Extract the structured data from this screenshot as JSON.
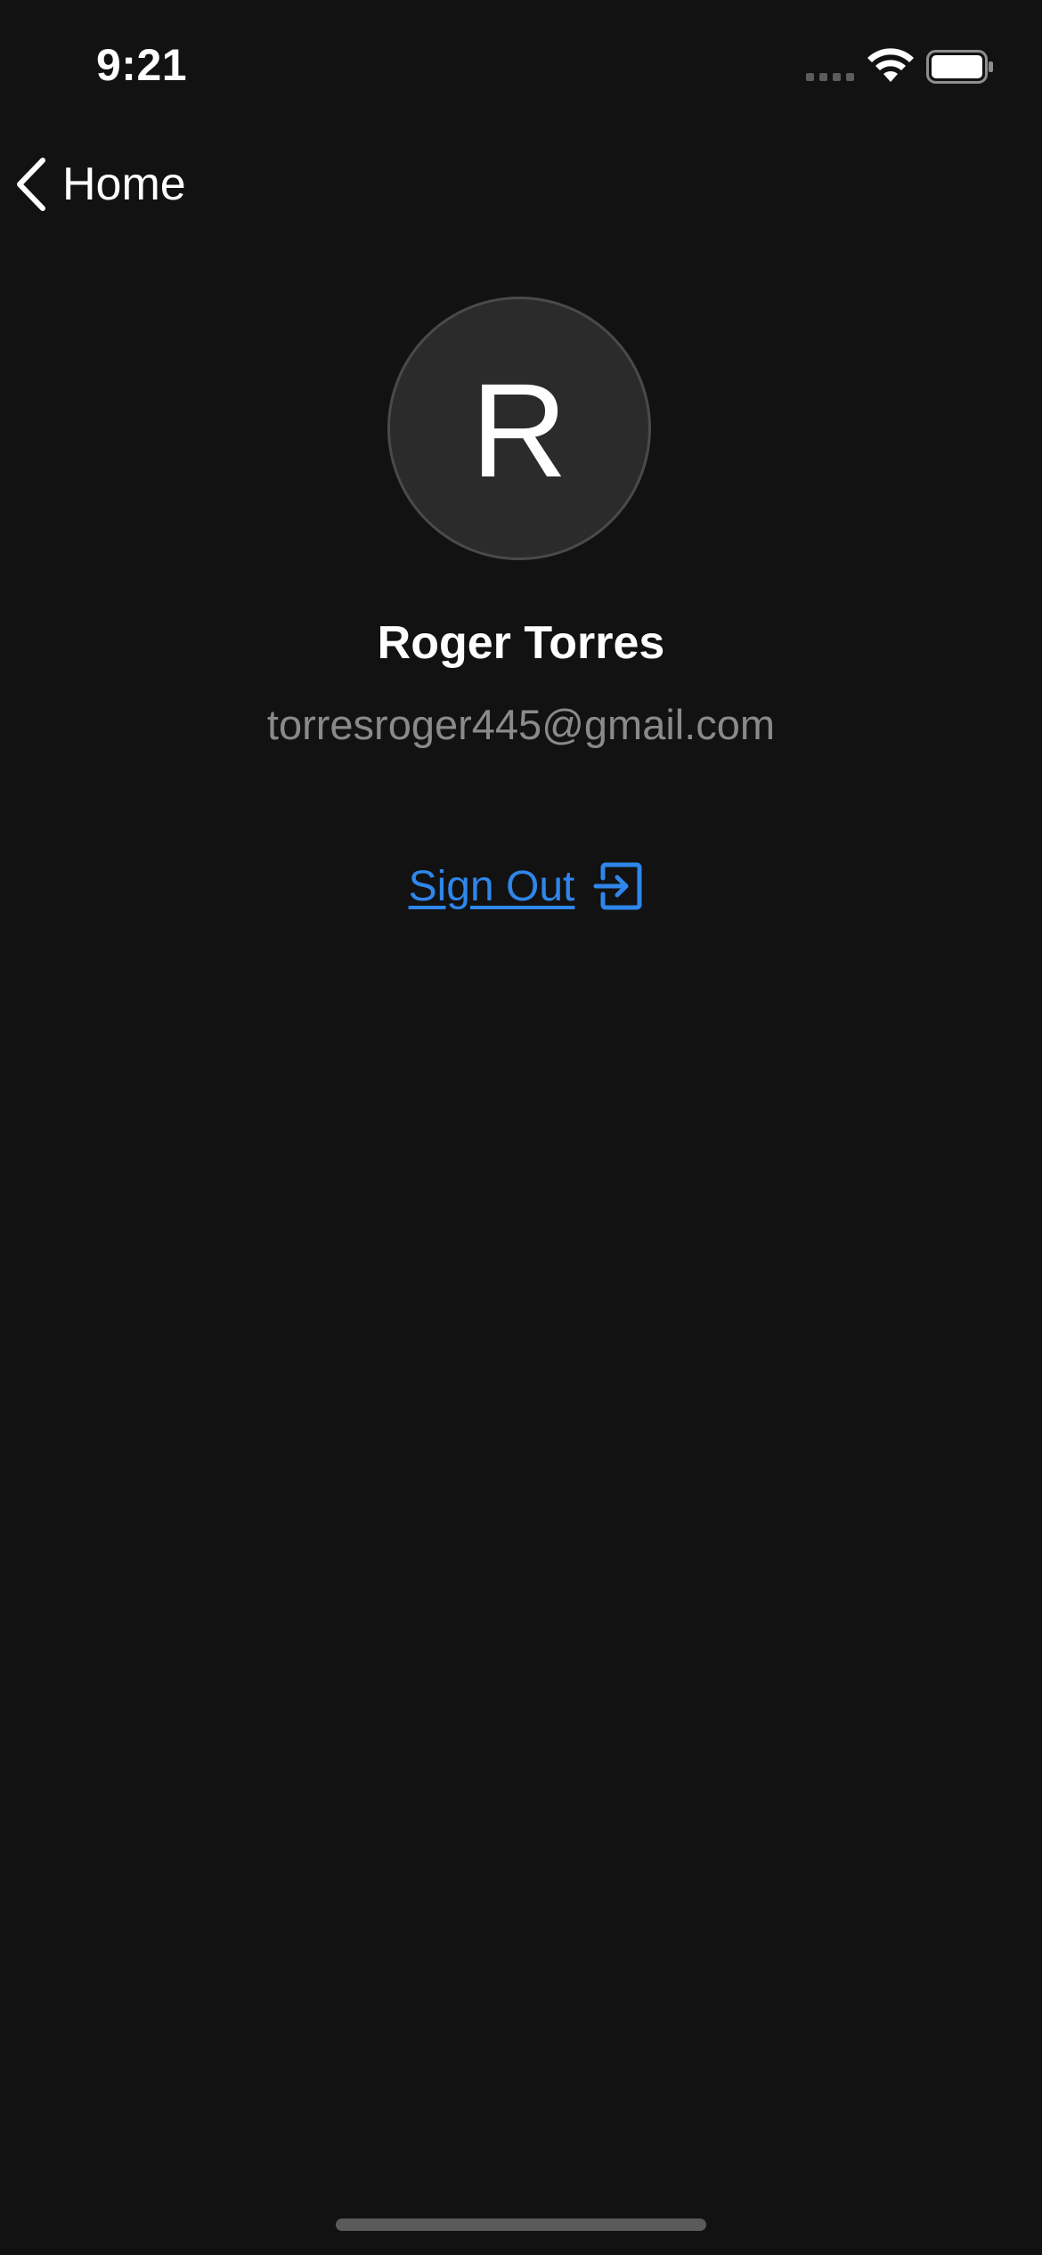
{
  "status_bar": {
    "time": "9:21"
  },
  "nav": {
    "back_label": "Home",
    "back_icon": "chevron-left-icon"
  },
  "profile": {
    "avatar_initial": "R",
    "name": "Roger Torres",
    "email": "torresroger445@gmail.com"
  },
  "actions": {
    "sign_out_label": "Sign Out",
    "sign_out_icon": "sign-out-icon"
  },
  "colors": {
    "background": "#121212",
    "accent": "#2f86eb",
    "avatar_bg": "#2b2b2b",
    "secondary_text": "#8a8a8a"
  }
}
